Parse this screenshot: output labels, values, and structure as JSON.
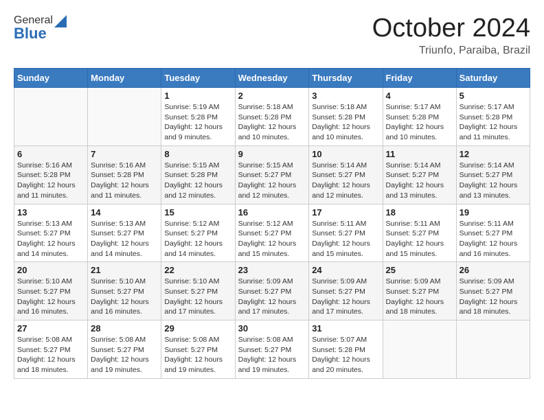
{
  "logo": {
    "line1": "General",
    "line2": "Blue"
  },
  "title": "October 2024",
  "location": "Triunfo, Paraiba, Brazil",
  "weekdays": [
    "Sunday",
    "Monday",
    "Tuesday",
    "Wednesday",
    "Thursday",
    "Friday",
    "Saturday"
  ],
  "weeks": [
    [
      {
        "day": "",
        "info": ""
      },
      {
        "day": "",
        "info": ""
      },
      {
        "day": "1",
        "info": "Sunrise: 5:19 AM\nSunset: 5:28 PM\nDaylight: 12 hours and 9 minutes."
      },
      {
        "day": "2",
        "info": "Sunrise: 5:18 AM\nSunset: 5:28 PM\nDaylight: 12 hours and 10 minutes."
      },
      {
        "day": "3",
        "info": "Sunrise: 5:18 AM\nSunset: 5:28 PM\nDaylight: 12 hours and 10 minutes."
      },
      {
        "day": "4",
        "info": "Sunrise: 5:17 AM\nSunset: 5:28 PM\nDaylight: 12 hours and 10 minutes."
      },
      {
        "day": "5",
        "info": "Sunrise: 5:17 AM\nSunset: 5:28 PM\nDaylight: 12 hours and 11 minutes."
      }
    ],
    [
      {
        "day": "6",
        "info": "Sunrise: 5:16 AM\nSunset: 5:28 PM\nDaylight: 12 hours and 11 minutes."
      },
      {
        "day": "7",
        "info": "Sunrise: 5:16 AM\nSunset: 5:28 PM\nDaylight: 12 hours and 11 minutes."
      },
      {
        "day": "8",
        "info": "Sunrise: 5:15 AM\nSunset: 5:28 PM\nDaylight: 12 hours and 12 minutes."
      },
      {
        "day": "9",
        "info": "Sunrise: 5:15 AM\nSunset: 5:27 PM\nDaylight: 12 hours and 12 minutes."
      },
      {
        "day": "10",
        "info": "Sunrise: 5:14 AM\nSunset: 5:27 PM\nDaylight: 12 hours and 12 minutes."
      },
      {
        "day": "11",
        "info": "Sunrise: 5:14 AM\nSunset: 5:27 PM\nDaylight: 12 hours and 13 minutes."
      },
      {
        "day": "12",
        "info": "Sunrise: 5:14 AM\nSunset: 5:27 PM\nDaylight: 12 hours and 13 minutes."
      }
    ],
    [
      {
        "day": "13",
        "info": "Sunrise: 5:13 AM\nSunset: 5:27 PM\nDaylight: 12 hours and 14 minutes."
      },
      {
        "day": "14",
        "info": "Sunrise: 5:13 AM\nSunset: 5:27 PM\nDaylight: 12 hours and 14 minutes."
      },
      {
        "day": "15",
        "info": "Sunrise: 5:12 AM\nSunset: 5:27 PM\nDaylight: 12 hours and 14 minutes."
      },
      {
        "day": "16",
        "info": "Sunrise: 5:12 AM\nSunset: 5:27 PM\nDaylight: 12 hours and 15 minutes."
      },
      {
        "day": "17",
        "info": "Sunrise: 5:11 AM\nSunset: 5:27 PM\nDaylight: 12 hours and 15 minutes."
      },
      {
        "day": "18",
        "info": "Sunrise: 5:11 AM\nSunset: 5:27 PM\nDaylight: 12 hours and 15 minutes."
      },
      {
        "day": "19",
        "info": "Sunrise: 5:11 AM\nSunset: 5:27 PM\nDaylight: 12 hours and 16 minutes."
      }
    ],
    [
      {
        "day": "20",
        "info": "Sunrise: 5:10 AM\nSunset: 5:27 PM\nDaylight: 12 hours and 16 minutes."
      },
      {
        "day": "21",
        "info": "Sunrise: 5:10 AM\nSunset: 5:27 PM\nDaylight: 12 hours and 16 minutes."
      },
      {
        "day": "22",
        "info": "Sunrise: 5:10 AM\nSunset: 5:27 PM\nDaylight: 12 hours and 17 minutes."
      },
      {
        "day": "23",
        "info": "Sunrise: 5:09 AM\nSunset: 5:27 PM\nDaylight: 12 hours and 17 minutes."
      },
      {
        "day": "24",
        "info": "Sunrise: 5:09 AM\nSunset: 5:27 PM\nDaylight: 12 hours and 17 minutes."
      },
      {
        "day": "25",
        "info": "Sunrise: 5:09 AM\nSunset: 5:27 PM\nDaylight: 12 hours and 18 minutes."
      },
      {
        "day": "26",
        "info": "Sunrise: 5:09 AM\nSunset: 5:27 PM\nDaylight: 12 hours and 18 minutes."
      }
    ],
    [
      {
        "day": "27",
        "info": "Sunrise: 5:08 AM\nSunset: 5:27 PM\nDaylight: 12 hours and 18 minutes."
      },
      {
        "day": "28",
        "info": "Sunrise: 5:08 AM\nSunset: 5:27 PM\nDaylight: 12 hours and 19 minutes."
      },
      {
        "day": "29",
        "info": "Sunrise: 5:08 AM\nSunset: 5:27 PM\nDaylight: 12 hours and 19 minutes."
      },
      {
        "day": "30",
        "info": "Sunrise: 5:08 AM\nSunset: 5:27 PM\nDaylight: 12 hours and 19 minutes."
      },
      {
        "day": "31",
        "info": "Sunrise: 5:07 AM\nSunset: 5:28 PM\nDaylight: 12 hours and 20 minutes."
      },
      {
        "day": "",
        "info": ""
      },
      {
        "day": "",
        "info": ""
      }
    ]
  ]
}
